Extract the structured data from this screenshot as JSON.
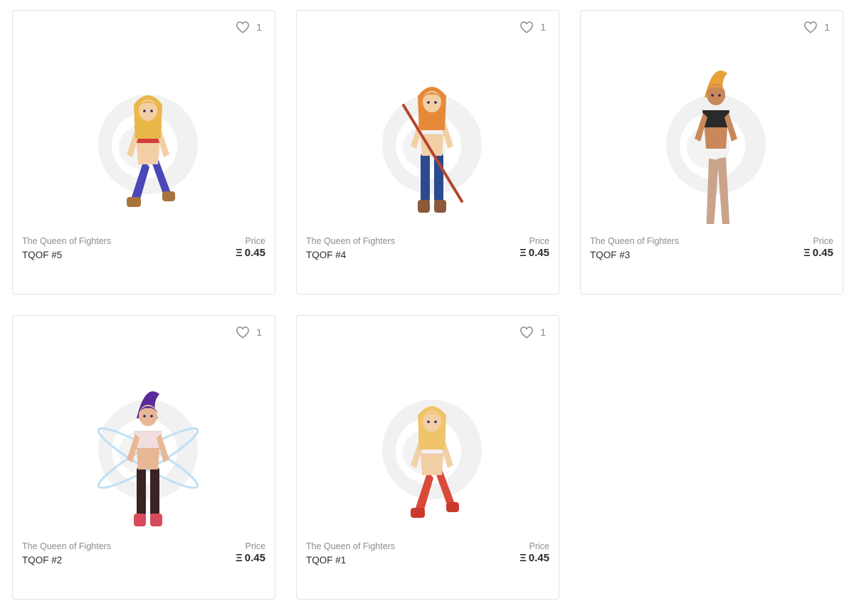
{
  "cards": [
    {
      "collection": "The Queen of Fighters",
      "name": "TQOF #5",
      "likes": "1",
      "price_label": "Price",
      "currency": "Ξ",
      "price": "0.45",
      "hair": "#e9b84a",
      "top": "#d93b3b",
      "pants": "#4a47b8",
      "boots": "#a8743c",
      "skin": "#f3cfa6"
    },
    {
      "collection": "The Queen of Fighters",
      "name": "TQOF #4",
      "likes": "1",
      "price_label": "Price",
      "currency": "Ξ",
      "price": "0.45",
      "hair": "#e68a3a",
      "top": "#f2f2f2",
      "pants": "#2b4b8f",
      "boots": "#8a5a3a",
      "skin": "#f3cfa6"
    },
    {
      "collection": "The Queen of Fighters",
      "name": "TQOF #3",
      "likes": "1",
      "price_label": "Price",
      "currency": "Ξ",
      "price": "0.45",
      "hair": "#e9a23b",
      "top": "#2a2a2a",
      "pants": "#c9a48a",
      "boots": "#e0409a",
      "skin": "#c9885a"
    },
    {
      "collection": "The Queen of Fighters",
      "name": "TQOF #2",
      "likes": "1",
      "price_label": "Price",
      "currency": "Ξ",
      "price": "0.45",
      "hair": "#5a2a9a",
      "top": "#f2dede",
      "pants": "#3a2323",
      "boots": "#d94a5a",
      "skin": "#e8b896"
    },
    {
      "collection": "The Queen of Fighters",
      "name": "TQOF #1",
      "likes": "1",
      "price_label": "Price",
      "currency": "Ξ",
      "price": "0.45",
      "hair": "#efc46a",
      "top": "#f2eeee",
      "pants": "#d94a3a",
      "boots": "#c93a2a",
      "skin": "#f3cfa6"
    }
  ]
}
